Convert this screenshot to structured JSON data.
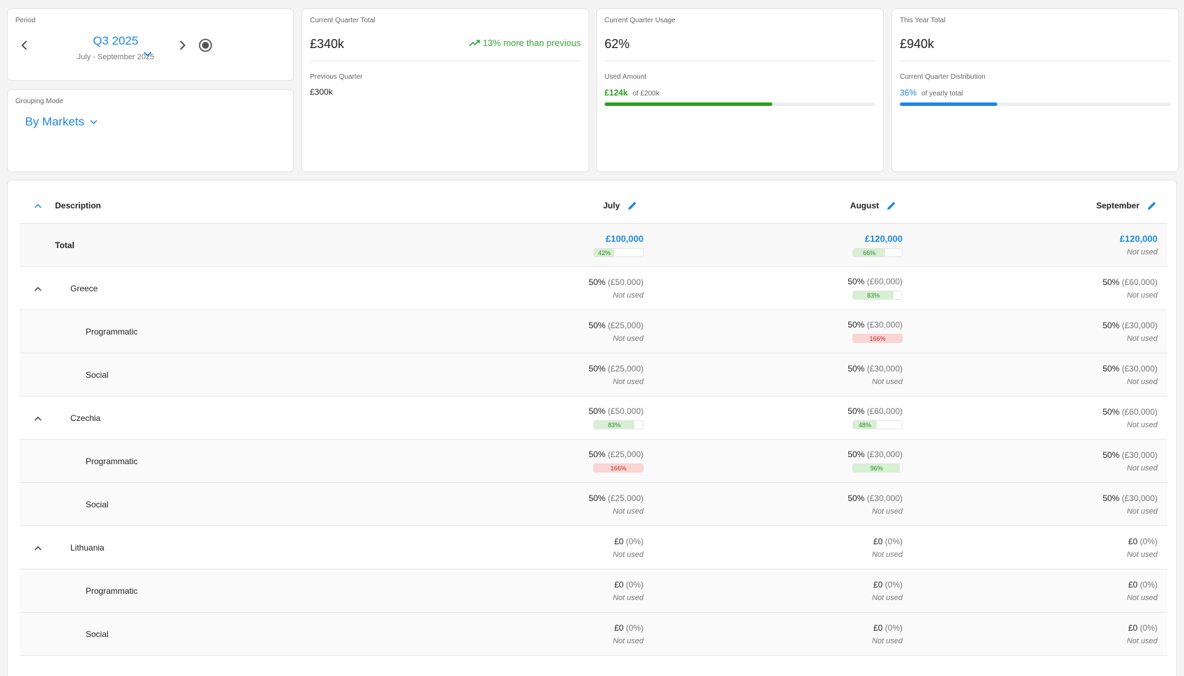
{
  "period": {
    "label": "Period",
    "value": "Q3 2025",
    "range": "July - September 2025"
  },
  "grouping": {
    "label": "Grouping Mode",
    "value": "By Markets"
  },
  "stats": {
    "quarter_total": {
      "label": "Current Quarter Total",
      "value": "£340k",
      "trend": "13% more than previous",
      "sub_label": "Previous Quarter",
      "sub_value": "£300k"
    },
    "quarter_usage": {
      "label": "Current Quarter Usage",
      "value": "62%",
      "sub_label": "Used Amount",
      "used": "£124k",
      "of_total": "of £200k",
      "progress": 0.62,
      "color": "#2e9e1f"
    },
    "year_total": {
      "label": "This Year Total",
      "value": "£940k",
      "sub_label": "Current Quarter Distribution",
      "percent": "36%",
      "note": "of yearly total",
      "progress": 0.36,
      "color": "#1e88e5"
    }
  },
  "table": {
    "header": {
      "description": "Description",
      "months": [
        "July",
        "August",
        "September"
      ]
    },
    "total": {
      "label": "Total",
      "cells": [
        {
          "amount": "£100,000",
          "usage": {
            "type": "green",
            "pct": 42,
            "text": "42%"
          }
        },
        {
          "amount": "£120,000",
          "usage": {
            "type": "green",
            "pct": 66,
            "text": "66%"
          }
        },
        {
          "amount": "£120,000",
          "usage": {
            "type": "not-used",
            "text": "Not used"
          }
        }
      ]
    },
    "rows": [
      {
        "label": "Greece",
        "level": 0,
        "cells": [
          {
            "share": "50%",
            "paren": "(£50,000)",
            "usage": {
              "type": "not-used",
              "text": "Not used"
            }
          },
          {
            "share": "50%",
            "paren": "(£60,000)",
            "usage": {
              "type": "green",
              "pct": 83,
              "text": "83%"
            }
          },
          {
            "share": "50%",
            "paren": "(£60,000)",
            "usage": {
              "type": "not-used",
              "text": "Not used"
            }
          }
        ]
      },
      {
        "label": "Programmatic",
        "level": 1,
        "cells": [
          {
            "share": "50%",
            "paren": "(£25,000)",
            "usage": {
              "type": "not-used",
              "text": "Not used"
            }
          },
          {
            "share": "50%",
            "paren": "(£30,000)",
            "usage": {
              "type": "red",
              "pct": 100,
              "text": "166%"
            }
          },
          {
            "share": "50%",
            "paren": "(£30,000)",
            "usage": {
              "type": "not-used",
              "text": "Not used"
            }
          }
        ]
      },
      {
        "label": "Social",
        "level": 1,
        "cells": [
          {
            "share": "50%",
            "paren": "(£25,000)",
            "usage": {
              "type": "not-used",
              "text": "Not used"
            }
          },
          {
            "share": "50%",
            "paren": "(£30,000)",
            "usage": {
              "type": "not-used",
              "text": "Not used"
            }
          },
          {
            "share": "50%",
            "paren": "(£30,000)",
            "usage": {
              "type": "not-used",
              "text": "Not used"
            }
          }
        ]
      },
      {
        "label": "Czechia",
        "level": 0,
        "cells": [
          {
            "share": "50%",
            "paren": "(£50,000)",
            "usage": {
              "type": "green",
              "pct": 83,
              "text": "83%"
            }
          },
          {
            "share": "50%",
            "paren": "(£60,000)",
            "usage": {
              "type": "green",
              "pct": 48,
              "text": "48%"
            }
          },
          {
            "share": "50%",
            "paren": "(£60,000)",
            "usage": {
              "type": "not-used",
              "text": "Not used"
            }
          }
        ]
      },
      {
        "label": "Programmatic",
        "level": 1,
        "cells": [
          {
            "share": "50%",
            "paren": "(£25,000)",
            "usage": {
              "type": "red",
              "pct": 100,
              "text": "166%"
            }
          },
          {
            "share": "50%",
            "paren": "(£30,000)",
            "usage": {
              "type": "green",
              "pct": 96,
              "text": "96%"
            }
          },
          {
            "share": "50%",
            "paren": "(£30,000)",
            "usage": {
              "type": "not-used",
              "text": "Not used"
            }
          }
        ]
      },
      {
        "label": "Social",
        "level": 1,
        "cells": [
          {
            "share": "50%",
            "paren": "(£25,000)",
            "usage": {
              "type": "not-used",
              "text": "Not used"
            }
          },
          {
            "share": "50%",
            "paren": "(£30,000)",
            "usage": {
              "type": "not-used",
              "text": "Not used"
            }
          },
          {
            "share": "50%",
            "paren": "(£30,000)",
            "usage": {
              "type": "not-used",
              "text": "Not used"
            }
          }
        ]
      },
      {
        "label": "Lithuania",
        "level": 0,
        "cells": [
          {
            "share": "£0",
            "paren": "(0%)",
            "usage": {
              "type": "not-used",
              "text": "Not used"
            }
          },
          {
            "share": "£0",
            "paren": "(0%)",
            "usage": {
              "type": "not-used",
              "text": "Not used"
            }
          },
          {
            "share": "£0",
            "paren": "(0%)",
            "usage": {
              "type": "not-used",
              "text": "Not used"
            }
          }
        ]
      },
      {
        "label": "Programmatic",
        "level": 1,
        "cells": [
          {
            "share": "£0",
            "paren": "(0%)",
            "usage": {
              "type": "not-used",
              "text": "Not used"
            }
          },
          {
            "share": "£0",
            "paren": "(0%)",
            "usage": {
              "type": "not-used",
              "text": "Not used"
            }
          },
          {
            "share": "£0",
            "paren": "(0%)",
            "usage": {
              "type": "not-used",
              "text": "Not used"
            }
          }
        ]
      },
      {
        "label": "Social",
        "level": 1,
        "cells": [
          {
            "share": "£0",
            "paren": "(0%)",
            "usage": {
              "type": "not-used",
              "text": "Not used"
            }
          },
          {
            "share": "£0",
            "paren": "(0%)",
            "usage": {
              "type": "not-used",
              "text": "Not used"
            }
          },
          {
            "share": "£0",
            "paren": "(0%)",
            "usage": {
              "type": "not-used",
              "text": "Not used"
            }
          }
        ]
      }
    ]
  }
}
